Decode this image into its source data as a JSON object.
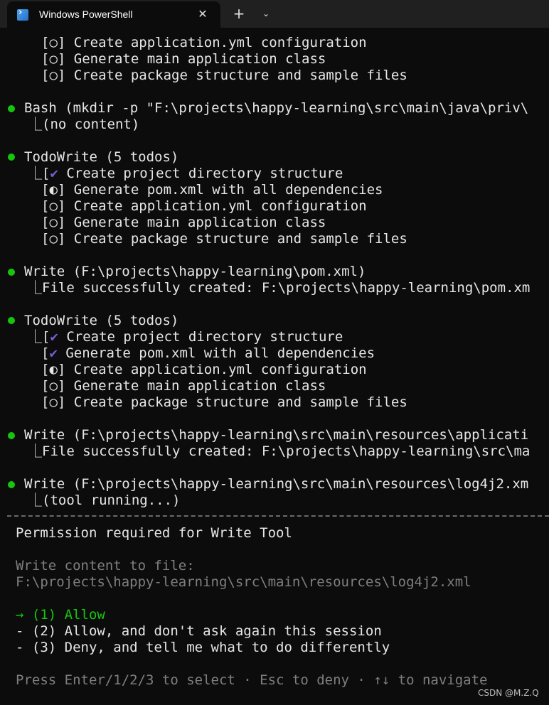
{
  "window": {
    "tab_title": "Windows PowerShell",
    "close_glyph": "✕",
    "new_tab_glyph": "+",
    "menu_glyph": "⌄",
    "icon": "powershell-icon"
  },
  "terminal": {
    "prev_todos": [
      "[○] Create application.yml configuration",
      "[○] Generate main application class",
      "[○] Create package structure and sample files"
    ],
    "bash": {
      "header": "Bash (mkdir -p \"F:\\projects\\happy-learning\\src\\main\\java\\priv\\",
      "result": "⎿(no content)"
    },
    "todo1": {
      "header": "TodoWrite (5 todos)",
      "items": [
        {
          "prefix": "⎿[",
          "mark": "✔",
          "text": " Create project directory structure"
        },
        {
          "prefix": "[◐]",
          "mark": "",
          "text": " Generate pom.xml with all dependencies"
        },
        {
          "prefix": "[○]",
          "mark": "",
          "text": " Create application.yml configuration"
        },
        {
          "prefix": "[○]",
          "mark": "",
          "text": " Generate main application class"
        },
        {
          "prefix": "[○]",
          "mark": "",
          "text": " Create package structure and sample files"
        }
      ]
    },
    "write1": {
      "header": "Write (F:\\projects\\happy-learning\\pom.xml)",
      "result": "⎿File successfully created: F:\\projects\\happy-learning\\pom.xm"
    },
    "todo2": {
      "header": "TodoWrite (5 todos)",
      "items": [
        {
          "prefix": "⎿[",
          "mark": "✔",
          "text": " Create project directory structure"
        },
        {
          "prefix": "[",
          "mark": "✔",
          "text": " Generate pom.xml with all dependencies"
        },
        {
          "prefix": "[◐]",
          "mark": "",
          "text": " Create application.yml configuration"
        },
        {
          "prefix": "[○]",
          "mark": "",
          "text": " Generate main application class"
        },
        {
          "prefix": "[○]",
          "mark": "",
          "text": " Create package structure and sample files"
        }
      ]
    },
    "write2": {
      "header": "Write (F:\\projects\\happy-learning\\src\\main\\resources\\applicati",
      "result": "⎿File successfully created: F:\\projects\\happy-learning\\src\\ma"
    },
    "write3": {
      "header": "Write (F:\\projects\\happy-learning\\src\\main\\resources\\log4j2.xm",
      "result": "⎿(tool running...)"
    },
    "permission": {
      "title": "Permission required for Write Tool",
      "desc_line1": "Write content to file:",
      "desc_line2": "F:\\projects\\happy-learning\\src\\main\\resources\\log4j2.xml",
      "options": [
        "→ (1) Allow",
        "- (2) Allow, and don't ask again this session",
        "- (3) Deny, and tell me what to do differently"
      ],
      "hint": "Press Enter/1/2/3 to select · Esc to deny · ↑↓ to navigate"
    },
    "colors": {
      "bullet": "#16c60c",
      "check": "#7a5cd6",
      "dim": "#7f7f7f",
      "accent": "#16c60c"
    }
  },
  "watermark": "CSDN @M.Z.Q"
}
